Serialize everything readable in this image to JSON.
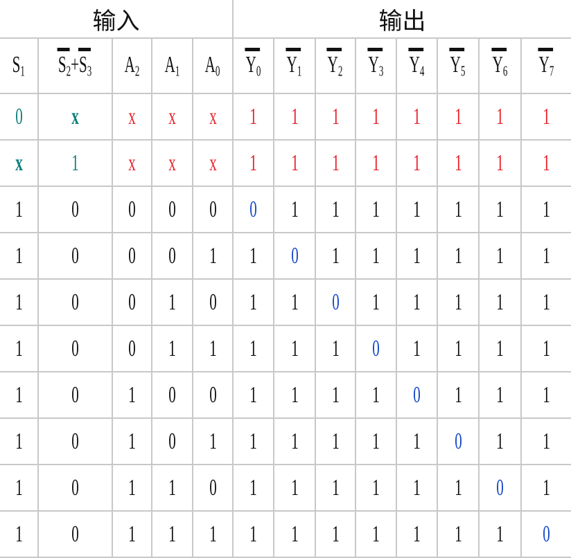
{
  "header": {
    "inputs": "输入",
    "outputs": "输出"
  },
  "columns": [
    {
      "base": "S",
      "sub": "1",
      "bar": false
    },
    {
      "expr": [
        {
          "base": "S",
          "sub": "2",
          "bar": true
        },
        {
          "text": "+"
        },
        {
          "base": "S",
          "sub": "3",
          "bar": true
        }
      ]
    },
    {
      "base": "A",
      "sub": "2",
      "bar": false
    },
    {
      "base": "A",
      "sub": "1",
      "bar": false
    },
    {
      "base": "A",
      "sub": "0",
      "bar": false
    },
    {
      "base": "Y",
      "sub": "0",
      "bar": true
    },
    {
      "base": "Y",
      "sub": "1",
      "bar": true
    },
    {
      "base": "Y",
      "sub": "2",
      "bar": true
    },
    {
      "base": "Y",
      "sub": "3",
      "bar": true
    },
    {
      "base": "Y",
      "sub": "4",
      "bar": true
    },
    {
      "base": "Y",
      "sub": "5",
      "bar": true
    },
    {
      "base": "Y",
      "sub": "6",
      "bar": true
    },
    {
      "base": "Y",
      "sub": "7",
      "bar": true
    }
  ],
  "colors": {
    "teal": "#0f7f7f",
    "red": "#e8202a",
    "blue": "#1447c8",
    "black": "#111111"
  },
  "rows": [
    [
      "0",
      "x",
      "x",
      "x",
      "x",
      "1",
      "1",
      "1",
      "1",
      "1",
      "1",
      "1",
      "1"
    ],
    [
      "x",
      "1",
      "x",
      "x",
      "x",
      "1",
      "1",
      "1",
      "1",
      "1",
      "1",
      "1",
      "1"
    ],
    [
      "1",
      "0",
      "0",
      "0",
      "0",
      "0",
      "1",
      "1",
      "1",
      "1",
      "1",
      "1",
      "1"
    ],
    [
      "1",
      "0",
      "0",
      "0",
      "1",
      "1",
      "0",
      "1",
      "1",
      "1",
      "1",
      "1",
      "1"
    ],
    [
      "1",
      "0",
      "0",
      "1",
      "0",
      "1",
      "1",
      "0",
      "1",
      "1",
      "1",
      "1",
      "1"
    ],
    [
      "1",
      "0",
      "0",
      "1",
      "1",
      "1",
      "1",
      "1",
      "0",
      "1",
      "1",
      "1",
      "1"
    ],
    [
      "1",
      "0",
      "1",
      "0",
      "0",
      "1",
      "1",
      "1",
      "1",
      "0",
      "1",
      "1",
      "1"
    ],
    [
      "1",
      "0",
      "1",
      "0",
      "1",
      "1",
      "1",
      "1",
      "1",
      "1",
      "0",
      "1",
      "1"
    ],
    [
      "1",
      "0",
      "1",
      "1",
      "0",
      "1",
      "1",
      "1",
      "1",
      "1",
      "1",
      "0",
      "1"
    ],
    [
      "1",
      "0",
      "1",
      "1",
      "1",
      "1",
      "1",
      "1",
      "1",
      "1",
      "1",
      "1",
      "0"
    ]
  ],
  "row_colors": [
    [
      "teal",
      "teal",
      "red",
      "red",
      "red",
      "red",
      "red",
      "red",
      "red",
      "red",
      "red",
      "red",
      "red"
    ],
    [
      "teal",
      "teal",
      "red",
      "red",
      "red",
      "red",
      "red",
      "red",
      "red",
      "red",
      "red",
      "red",
      "red"
    ]
  ]
}
